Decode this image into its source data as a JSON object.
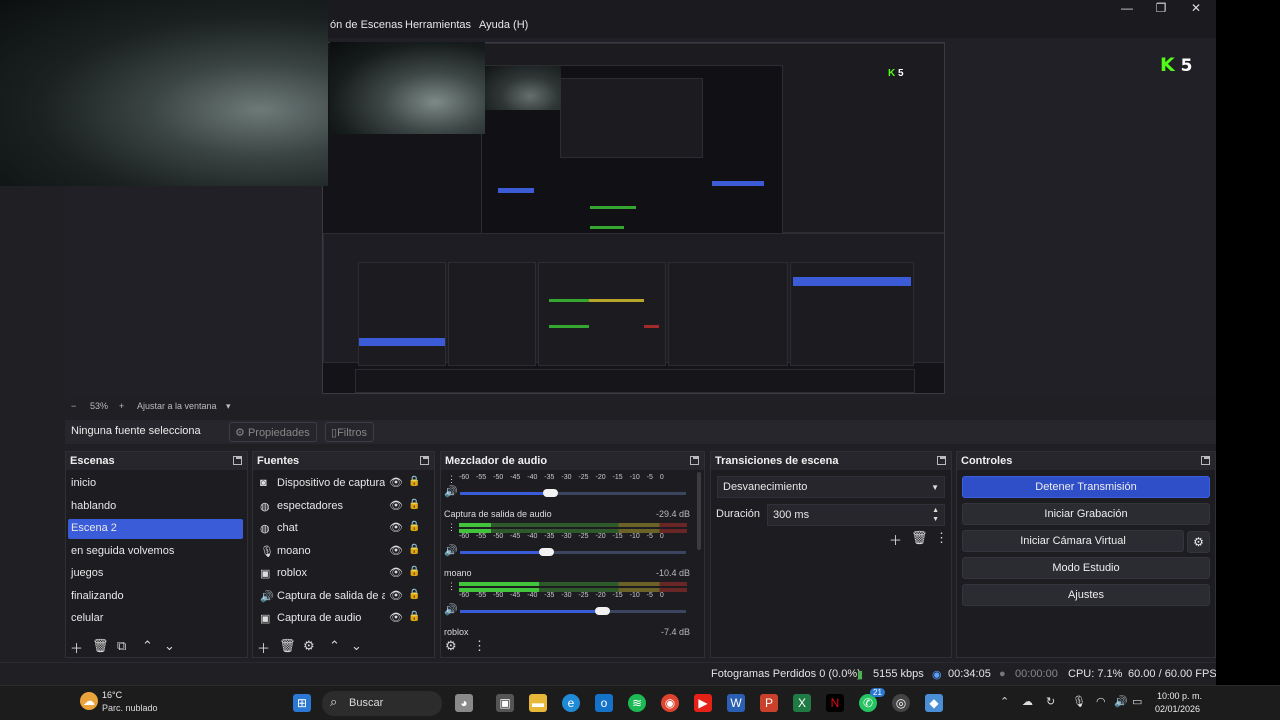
{
  "window": {
    "menu": [
      "ón de Escenas",
      "Herramientas",
      "Ayuda (H)"
    ],
    "controls": [
      "—",
      "❐",
      "✕"
    ]
  },
  "overlay": {
    "logo_letter": "K",
    "logo_number": "5"
  },
  "zoombar": {
    "minus": "−",
    "zoom": "53%",
    "plus": "+",
    "fit": "Ajustar a la ventana",
    "caret": "▾"
  },
  "context": {
    "label": "Ninguna fuente selecciona",
    "properties": "Propiedades",
    "filters": "Filtros"
  },
  "scenes": {
    "title": "Escenas",
    "items": [
      "inicio",
      "hablando",
      "Escena 2",
      "en seguida volvemos",
      "juegos",
      "finalizando",
      "celular"
    ],
    "active_index": 2
  },
  "sources": {
    "title": "Fuentes",
    "items": [
      {
        "icon": "camera-icon",
        "glyph": "◙",
        "name": "Dispositivo de captura de video"
      },
      {
        "icon": "globe-icon",
        "glyph": "◍",
        "name": "espectadores"
      },
      {
        "icon": "globe-icon",
        "glyph": "◍",
        "name": "chat"
      },
      {
        "icon": "microphone-icon",
        "glyph": "🎙",
        "name": "moano"
      },
      {
        "icon": "window-icon",
        "glyph": "▣",
        "name": "roblox"
      },
      {
        "icon": "speaker-icon",
        "glyph": "🔊",
        "name": "Captura de salida de audio"
      },
      {
        "icon": "window-icon",
        "glyph": "▣",
        "name": "Captura de audio"
      }
    ]
  },
  "mixer": {
    "title": "Mezclador de audio",
    "scale": "-60 -55 -50 -45 -40 -35 -30 -25 -20 -15 -10 -5 0",
    "channels": [
      {
        "name": "",
        "db": "",
        "level": 0.0,
        "volume": 0.4
      },
      {
        "name": "Captura de salida de audio",
        "db": "-29.4 dB",
        "level": 0.14,
        "volume": 0.38
      },
      {
        "name": "moano",
        "db": "-10.4 dB",
        "level": 0.35,
        "volume": 0.63
      },
      {
        "name": "roblox",
        "db": "-7.4 dB",
        "level": 0.0,
        "volume": 0.0
      }
    ]
  },
  "transitions": {
    "title": "Transiciones de escena",
    "selected": "Desvanecimiento",
    "duration_label": "Duración",
    "duration_value": "300 ms"
  },
  "controls": {
    "title": "Controles",
    "stop_stream": "Detener Transmisión",
    "start_recording": "Iniciar Grabación",
    "start_vcam": "Iniciar Cámara Virtual",
    "studio_mode": "Modo Estudio",
    "settings": "Ajustes"
  },
  "status": {
    "dropped": "Fotogramas Perdidos 0 (0.0%)",
    "bitrate": "5155 kbps",
    "live_time": "00:34:05",
    "rec_time": "00:00:00",
    "cpu": "CPU: 7.1%",
    "fps": "60.00 / 60.00 FPS"
  },
  "taskbar": {
    "weather_temp": "16°C",
    "weather_desc": "Parc. nublado",
    "search": "Buscar",
    "time": "10:00 p. m.",
    "date": "02/01/2026",
    "badge": "21"
  },
  "colors": {
    "accent": "#3a5cd8",
    "panel": "#1c1c21",
    "kick_green": "#53fc18"
  }
}
